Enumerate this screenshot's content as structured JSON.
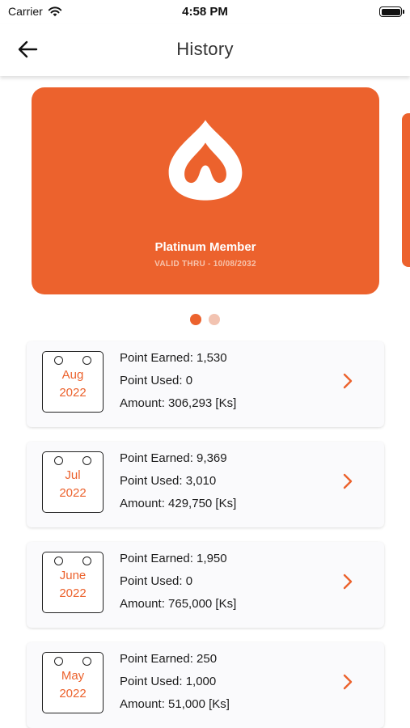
{
  "status_bar": {
    "carrier": "Carrier",
    "time": "4:58 PM"
  },
  "nav": {
    "title": "History",
    "back_icon": "arrow-left-icon"
  },
  "card": {
    "tier": "Platinum Member",
    "valid_thru": "VALID THRU - 10/08/2032",
    "color": "#ec622d",
    "logo_icon": "flame-drop-logo"
  },
  "carousel": {
    "page_count": 2,
    "active_index": 0
  },
  "history": {
    "items": [
      {
        "month": "Aug",
        "year": "2022",
        "points_earned": "Point Earned: 1,530",
        "points_used": "Point Used: 0",
        "amount": "Amount: 306,293 [Ks]"
      },
      {
        "month": "Jul",
        "year": "2022",
        "points_earned": "Point Earned: 9,369",
        "points_used": "Point Used: 3,010",
        "amount": "Amount: 429,750 [Ks]"
      },
      {
        "month": "June",
        "year": "2022",
        "points_earned": "Point Earned: 1,950",
        "points_used": "Point Used: 0",
        "amount": "Amount: 765,000 [Ks]"
      },
      {
        "month": "May",
        "year": "2022",
        "points_earned": "Point Earned: 250",
        "points_used": "Point Used: 1,000",
        "amount": "Amount: 51,000 [Ks]"
      }
    ]
  },
  "colors": {
    "accent": "#ec622d",
    "dot_inactive": "#f2c3b1"
  }
}
